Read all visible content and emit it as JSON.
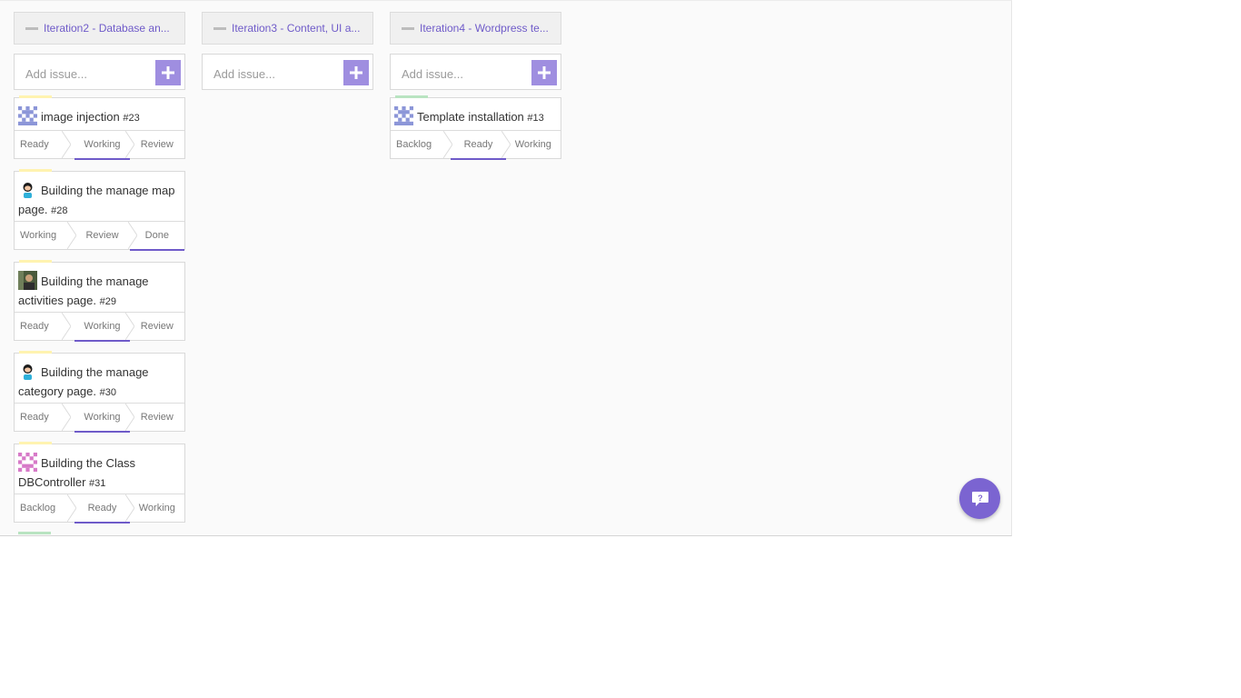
{
  "columns": [
    {
      "title": "Iteration2 - Database an...",
      "add_placeholder": "Add issue...",
      "cards": [
        {
          "title": "image injection",
          "number": "#23",
          "avatar": "identicon-blue",
          "stages": [
            "Ready",
            "Working",
            "Review"
          ],
          "active": 1
        },
        {
          "title": "Building the manage map page.",
          "number": "#28",
          "avatar": "octocat-avatar",
          "stages": [
            "Working",
            "Review",
            "Done"
          ],
          "active": 2
        },
        {
          "title": "Building the manage activities page.",
          "number": "#29",
          "avatar": "photo-avatar",
          "stages": [
            "Ready",
            "Working",
            "Review"
          ],
          "active": 1
        },
        {
          "title": "Building the manage category page.",
          "number": "#30",
          "avatar": "octocat-avatar",
          "stages": [
            "Ready",
            "Working",
            "Review"
          ],
          "active": 1
        },
        {
          "title": "Building the Class DBController",
          "number": "#31",
          "avatar": "identicon-pink",
          "stages": [
            "Backlog",
            "Ready",
            "Working"
          ],
          "active": 1
        }
      ]
    },
    {
      "title": "Iteration3 - Content, UI a...",
      "add_placeholder": "Add issue...",
      "cards": []
    },
    {
      "title": "Iteration4 - Wordpress te...",
      "add_placeholder": "Add issue...",
      "cards": [
        {
          "title": "Template installation",
          "number": "#13",
          "avatar": "identicon-blue",
          "stages": [
            "Backlog",
            "Ready",
            "Working"
          ],
          "active": 1
        }
      ]
    }
  ],
  "colors": {
    "accent": "#6f5bc9",
    "add_button": "#9f8ee0",
    "card_accent_yellow": "#fff3b0",
    "card_accent_green": "#b9e4c1"
  },
  "help_button_icon": "help-chat-icon"
}
